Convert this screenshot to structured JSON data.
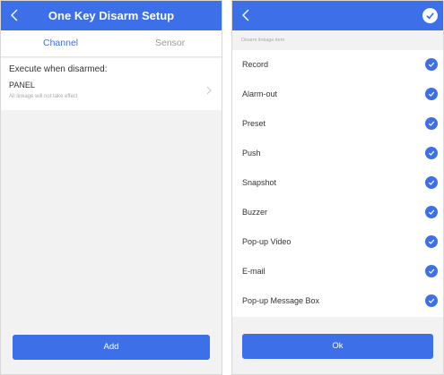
{
  "left_screen": {
    "title": "One Key Disarm Setup",
    "tabs": [
      {
        "label": "Channel"
      },
      {
        "label": "Sensor"
      }
    ],
    "execute_label": "Execute when disarmed:",
    "panel": {
      "name": "PANEL",
      "note": "All linkage will not take effect"
    },
    "add_button": "Add"
  },
  "right_screen": {
    "section_header": "Disarm linkage item",
    "items": [
      {
        "label": "Record"
      },
      {
        "label": "Alarm-out"
      },
      {
        "label": "Preset"
      },
      {
        "label": "Push"
      },
      {
        "label": "Snapshot"
      },
      {
        "label": "Buzzer"
      },
      {
        "label": "Pop-up Video"
      },
      {
        "label": "E-mail"
      },
      {
        "label": "Pop-up Message Box"
      }
    ],
    "ok_button": "Ok"
  },
  "colors": {
    "accent": "#3d6fe8",
    "background": "#f2f2f2",
    "muted_text": "#9a9a9a"
  },
  "icons": [
    "back-arrow-icon",
    "checkmark-icon",
    "chevron-right-icon"
  ]
}
